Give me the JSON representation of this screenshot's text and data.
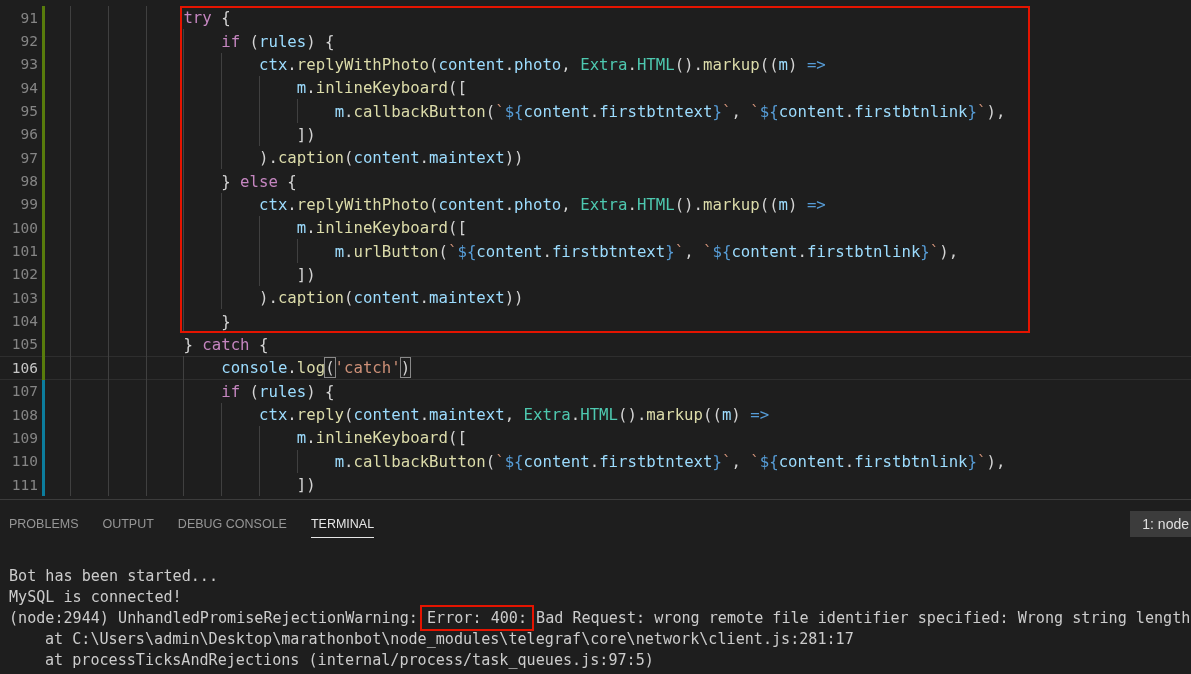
{
  "editor": {
    "lines": [
      {
        "number": "91",
        "color": "#587c0c",
        "current": false,
        "boxed": true,
        "tokens": [
          {
            "kind": "keyword",
            "text": "try"
          },
          {
            "kind": "punct",
            "text": " {"
          }
        ],
        "children": [
          {
            "number": "92",
            "color": "#587c0c",
            "current": false,
            "tokens": [
              {
                "kind": "keyword",
                "text": "if"
              },
              {
                "kind": "punct",
                "text": " ("
              },
              {
                "kind": "variable",
                "text": "rules"
              },
              {
                "kind": "punct",
                "text": ") {"
              }
            ],
            "children": [
              {
                "number": "93",
                "color": "#587c0c",
                "current": false,
                "tokens": [
                  {
                    "kind": "variable",
                    "text": "ctx"
                  },
                  {
                    "kind": "punct",
                    "text": "."
                  },
                  {
                    "kind": "function",
                    "text": "replyWithPhoto"
                  },
                  {
                    "kind": "punct",
                    "text": "("
                  },
                  {
                    "kind": "variable",
                    "text": "content"
                  },
                  {
                    "kind": "punct",
                    "text": "."
                  },
                  {
                    "kind": "variable",
                    "text": "photo"
                  },
                  {
                    "kind": "punct",
                    "text": ", "
                  },
                  {
                    "kind": "class",
                    "text": "Extra"
                  },
                  {
                    "kind": "punct",
                    "text": "."
                  },
                  {
                    "kind": "class",
                    "text": "HTML"
                  },
                  {
                    "kind": "punct",
                    "text": "()."
                  },
                  {
                    "kind": "function",
                    "text": "markup"
                  },
                  {
                    "kind": "punct",
                    "text": "(("
                  },
                  {
                    "kind": "variable",
                    "text": "m"
                  },
                  {
                    "kind": "punct",
                    "text": ") "
                  },
                  {
                    "kind": "operator",
                    "text": "=>"
                  }
                ],
                "children": [
                  {
                    "number": "94",
                    "color": "#587c0c",
                    "current": false,
                    "tokens": [
                      {
                        "kind": "variable",
                        "text": "m"
                      },
                      {
                        "kind": "punct",
                        "text": "."
                      },
                      {
                        "kind": "function",
                        "text": "inlineKeyboard"
                      },
                      {
                        "kind": "punct",
                        "text": "(["
                      }
                    ],
                    "children": [
                      {
                        "number": "95",
                        "color": "#587c0c",
                        "current": false,
                        "tokens": [
                          {
                            "kind": "variable",
                            "text": "m"
                          },
                          {
                            "kind": "punct",
                            "text": "."
                          },
                          {
                            "kind": "function",
                            "text": "callbackButton"
                          },
                          {
                            "kind": "punct",
                            "text": "("
                          },
                          {
                            "kind": "string",
                            "text": "`"
                          },
                          {
                            "kind": "operator",
                            "text": "${"
                          },
                          {
                            "kind": "variable",
                            "text": "content"
                          },
                          {
                            "kind": "punct",
                            "text": "."
                          },
                          {
                            "kind": "variable",
                            "text": "firstbtntext"
                          },
                          {
                            "kind": "operator",
                            "text": "}"
                          },
                          {
                            "kind": "string",
                            "text": "`"
                          },
                          {
                            "kind": "punct",
                            "text": ", "
                          },
                          {
                            "kind": "string",
                            "text": "`"
                          },
                          {
                            "kind": "operator",
                            "text": "${"
                          },
                          {
                            "kind": "variable",
                            "text": "content"
                          },
                          {
                            "kind": "punct",
                            "text": "."
                          },
                          {
                            "kind": "variable",
                            "text": "firstbtnlink"
                          },
                          {
                            "kind": "operator",
                            "text": "}"
                          },
                          {
                            "kind": "string",
                            "text": "`"
                          },
                          {
                            "kind": "punct",
                            "text": "),"
                          }
                        ]
                      }
                    ]
                  },
                  {
                    "number": "96",
                    "color": "#587c0c",
                    "current": false,
                    "tokens": [
                      {
                        "kind": "punct",
                        "text": "])"
                      }
                    ]
                  }
                ]
              },
              {
                "number": "97",
                "color": "#587c0c",
                "current": false,
                "tokens": [
                  {
                    "kind": "punct",
                    "text": ")."
                  },
                  {
                    "kind": "function",
                    "text": "caption"
                  },
                  {
                    "kind": "punct",
                    "text": "("
                  },
                  {
                    "kind": "variable",
                    "text": "content"
                  },
                  {
                    "kind": "punct",
                    "text": "."
                  },
                  {
                    "kind": "variable",
                    "text": "maintext"
                  },
                  {
                    "kind": "punct",
                    "text": "))"
                  }
                ]
              }
            ]
          },
          {
            "number": "98",
            "color": "#587c0c",
            "current": false,
            "tokens": [
              {
                "kind": "punct",
                "text": "} "
              },
              {
                "kind": "keyword",
                "text": "else"
              },
              {
                "kind": "punct",
                "text": " {"
              }
            ],
            "children": [
              {
                "number": "99",
                "color": "#587c0c",
                "current": false,
                "tokens": [
                  {
                    "kind": "variable",
                    "text": "ctx"
                  },
                  {
                    "kind": "punct",
                    "text": "."
                  },
                  {
                    "kind": "function",
                    "text": "replyWithPhoto"
                  },
                  {
                    "kind": "punct",
                    "text": "("
                  },
                  {
                    "kind": "variable",
                    "text": "content"
                  },
                  {
                    "kind": "punct",
                    "text": "."
                  },
                  {
                    "kind": "variable",
                    "text": "photo"
                  },
                  {
                    "kind": "punct",
                    "text": ", "
                  },
                  {
                    "kind": "class",
                    "text": "Extra"
                  },
                  {
                    "kind": "punct",
                    "text": "."
                  },
                  {
                    "kind": "class",
                    "text": "HTML"
                  },
                  {
                    "kind": "punct",
                    "text": "()."
                  },
                  {
                    "kind": "function",
                    "text": "markup"
                  },
                  {
                    "kind": "punct",
                    "text": "(("
                  },
                  {
                    "kind": "variable",
                    "text": "m"
                  },
                  {
                    "kind": "punct",
                    "text": ") "
                  },
                  {
                    "kind": "operator",
                    "text": "=>"
                  }
                ],
                "children": [
                  {
                    "number": "100",
                    "color": "#587c0c",
                    "current": false,
                    "tokens": [
                      {
                        "kind": "variable",
                        "text": "m"
                      },
                      {
                        "kind": "punct",
                        "text": "."
                      },
                      {
                        "kind": "function",
                        "text": "inlineKeyboard"
                      },
                      {
                        "kind": "punct",
                        "text": "(["
                      }
                    ],
                    "children": [
                      {
                        "number": "101",
                        "color": "#587c0c",
                        "current": false,
                        "tokens": [
                          {
                            "kind": "variable",
                            "text": "m"
                          },
                          {
                            "kind": "punct",
                            "text": "."
                          },
                          {
                            "kind": "function",
                            "text": "urlButton"
                          },
                          {
                            "kind": "punct",
                            "text": "("
                          },
                          {
                            "kind": "string",
                            "text": "`"
                          },
                          {
                            "kind": "operator",
                            "text": "${"
                          },
                          {
                            "kind": "variable",
                            "text": "content"
                          },
                          {
                            "kind": "punct",
                            "text": "."
                          },
                          {
                            "kind": "variable",
                            "text": "firstbtntext"
                          },
                          {
                            "kind": "operator",
                            "text": "}"
                          },
                          {
                            "kind": "string",
                            "text": "`"
                          },
                          {
                            "kind": "punct",
                            "text": ", "
                          },
                          {
                            "kind": "string",
                            "text": "`"
                          },
                          {
                            "kind": "operator",
                            "text": "${"
                          },
                          {
                            "kind": "variable",
                            "text": "content"
                          },
                          {
                            "kind": "punct",
                            "text": "."
                          },
                          {
                            "kind": "variable",
                            "text": "firstbtnlink"
                          },
                          {
                            "kind": "operator",
                            "text": "}"
                          },
                          {
                            "kind": "string",
                            "text": "`"
                          },
                          {
                            "kind": "punct",
                            "text": "),"
                          }
                        ]
                      }
                    ]
                  },
                  {
                    "number": "102",
                    "color": "#587c0c",
                    "current": false,
                    "tokens": [
                      {
                        "kind": "punct",
                        "text": "])"
                      }
                    ]
                  }
                ]
              },
              {
                "number": "103",
                "color": "#587c0c",
                "current": false,
                "tokens": [
                  {
                    "kind": "punct",
                    "text": ")."
                  },
                  {
                    "kind": "function",
                    "text": "caption"
                  },
                  {
                    "kind": "punct",
                    "text": "("
                  },
                  {
                    "kind": "variable",
                    "text": "content"
                  },
                  {
                    "kind": "punct",
                    "text": "."
                  },
                  {
                    "kind": "variable",
                    "text": "maintext"
                  },
                  {
                    "kind": "punct",
                    "text": "))"
                  }
                ]
              }
            ]
          },
          {
            "number": "104",
            "color": "#587c0c",
            "current": false,
            "tokens": [
              {
                "kind": "punct",
                "text": "}"
              }
            ]
          }
        ]
      },
      {
        "number": "105",
        "color": "#587c0c",
        "current": false,
        "boxed": false,
        "tokens": [
          {
            "kind": "punct",
            "text": "} "
          },
          {
            "kind": "keyword",
            "text": "catch"
          },
          {
            "kind": "punct",
            "text": " {"
          }
        ],
        "children": [
          {
            "number": "106",
            "color": "#587c0c",
            "current": true,
            "tokens": [
              {
                "kind": "variable",
                "text": "console"
              },
              {
                "kind": "punct",
                "text": "."
              },
              {
                "kind": "function",
                "text": "log"
              },
              {
                "kind": "bracket",
                "text": "("
              },
              {
                "kind": "string",
                "text": "'catch'"
              },
              {
                "kind": "bracket",
                "text": ")"
              }
            ]
          },
          {
            "number": "107",
            "color": "#0c7d9d",
            "current": false,
            "tokens": [
              {
                "kind": "keyword",
                "text": "if"
              },
              {
                "kind": "punct",
                "text": " ("
              },
              {
                "kind": "variable",
                "text": "rules"
              },
              {
                "kind": "punct",
                "text": ") {"
              }
            ],
            "children": [
              {
                "number": "108",
                "color": "#0c7d9d",
                "current": false,
                "tokens": [
                  {
                    "kind": "variable",
                    "text": "ctx"
                  },
                  {
                    "kind": "punct",
                    "text": "."
                  },
                  {
                    "kind": "function",
                    "text": "reply"
                  },
                  {
                    "kind": "punct",
                    "text": "("
                  },
                  {
                    "kind": "variable",
                    "text": "content"
                  },
                  {
                    "kind": "punct",
                    "text": "."
                  },
                  {
                    "kind": "variable",
                    "text": "maintext"
                  },
                  {
                    "kind": "punct",
                    "text": ", "
                  },
                  {
                    "kind": "class",
                    "text": "Extra"
                  },
                  {
                    "kind": "punct",
                    "text": "."
                  },
                  {
                    "kind": "class",
                    "text": "HTML"
                  },
                  {
                    "kind": "punct",
                    "text": "()."
                  },
                  {
                    "kind": "function",
                    "text": "markup"
                  },
                  {
                    "kind": "punct",
                    "text": "(("
                  },
                  {
                    "kind": "variable",
                    "text": "m"
                  },
                  {
                    "kind": "punct",
                    "text": ") "
                  },
                  {
                    "kind": "operator",
                    "text": "=>"
                  }
                ],
                "children": [
                  {
                    "number": "109",
                    "color": "#0c7d9d",
                    "current": false,
                    "tokens": [
                      {
                        "kind": "variable",
                        "text": "m"
                      },
                      {
                        "kind": "punct",
                        "text": "."
                      },
                      {
                        "kind": "function",
                        "text": "inlineKeyboard"
                      },
                      {
                        "kind": "punct",
                        "text": "(["
                      }
                    ],
                    "children": [
                      {
                        "number": "110",
                        "color": "#0c7d9d",
                        "current": false,
                        "tokens": [
                          {
                            "kind": "variable",
                            "text": "m"
                          },
                          {
                            "kind": "punct",
                            "text": "."
                          },
                          {
                            "kind": "function",
                            "text": "callbackButton"
                          },
                          {
                            "kind": "punct",
                            "text": "("
                          },
                          {
                            "kind": "string",
                            "text": "`"
                          },
                          {
                            "kind": "operator",
                            "text": "${"
                          },
                          {
                            "kind": "variable",
                            "text": "content"
                          },
                          {
                            "kind": "punct",
                            "text": "."
                          },
                          {
                            "kind": "variable",
                            "text": "firstbtntext"
                          },
                          {
                            "kind": "operator",
                            "text": "}"
                          },
                          {
                            "kind": "string",
                            "text": "`"
                          },
                          {
                            "kind": "punct",
                            "text": ", "
                          },
                          {
                            "kind": "string",
                            "text": "`"
                          },
                          {
                            "kind": "operator",
                            "text": "${"
                          },
                          {
                            "kind": "variable",
                            "text": "content"
                          },
                          {
                            "kind": "punct",
                            "text": "."
                          },
                          {
                            "kind": "variable",
                            "text": "firstbtnlink"
                          },
                          {
                            "kind": "operator",
                            "text": "}"
                          },
                          {
                            "kind": "string",
                            "text": "`"
                          },
                          {
                            "kind": "punct",
                            "text": "),"
                          }
                        ]
                      }
                    ]
                  },
                  {
                    "number": "111",
                    "color": "#0c7d9d",
                    "current": false,
                    "tokens": [
                      {
                        "kind": "punct",
                        "text": "])"
                      }
                    ]
                  }
                ]
              }
            ]
          }
        ]
      }
    ]
  },
  "panel": {
    "tabs": [
      {
        "label": "PROBLEMS",
        "selected": false
      },
      {
        "label": "OUTPUT",
        "selected": false
      },
      {
        "label": "DEBUG CONSOLE",
        "selected": false
      },
      {
        "label": "TERMINAL",
        "selected": true
      }
    ],
    "terminal_selector": "1: node",
    "terminal_lines": [
      {
        "kind": "message",
        "segments": [
          {
            "text": "Bot has been started...",
            "boxed": false
          }
        ]
      },
      {
        "kind": "message",
        "segments": [
          {
            "text": "MySQL is connected!",
            "boxed": false
          }
        ]
      },
      {
        "kind": "message",
        "segments": [
          {
            "text": "(node:2944) UnhandledPromiseRejectionWarning: ",
            "boxed": false
          },
          {
            "text": "Error: 400:",
            "boxed": true
          },
          {
            "text": " Bad Request: wrong remote file identifier specified: Wrong string length",
            "boxed": false
          }
        ]
      },
      {
        "kind": "trace",
        "segments": [
          {
            "text": "at C:\\Users\\admin\\Desktop\\marathonbot\\node_modules\\telegraf\\core\\network\\client.js:281:17",
            "boxed": false
          }
        ]
      },
      {
        "kind": "trace",
        "segments": [
          {
            "text": "at processTicksAndRejections (internal/process/task_queues.js:97:5)",
            "boxed": false
          }
        ]
      }
    ]
  }
}
